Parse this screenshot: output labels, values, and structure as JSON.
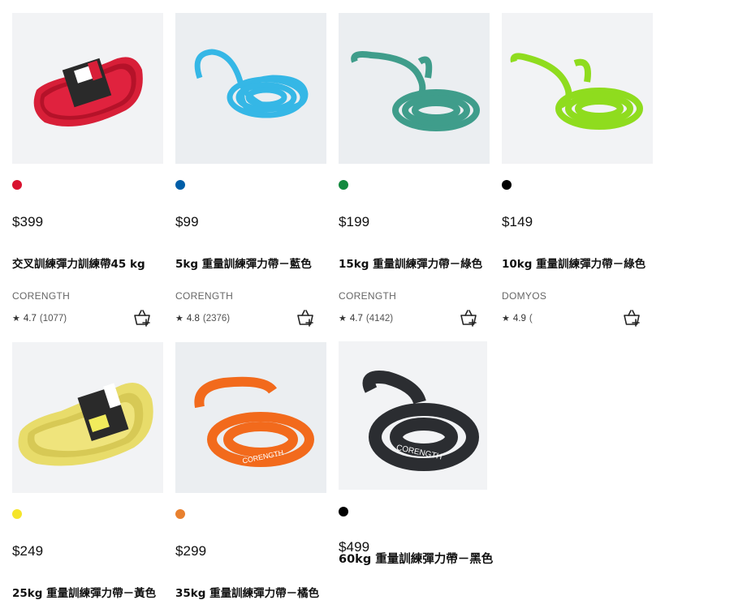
{
  "products": [
    {
      "price": "$399",
      "name": "交叉訓練彈力訓練帶45 kg",
      "brand": "CORENGTH",
      "rating": "4.7",
      "count": "(1077)",
      "swatch": "#d9122f",
      "band_color": "#e0223e",
      "icon": "red-resistance-band-image"
    },
    {
      "price": "$99",
      "name": "5kg 重量訓練彈力帶－藍色",
      "brand": "CORENGTH",
      "rating": "4.8",
      "count": "(2376)",
      "swatch": "#005ea8",
      "band_color": "#35b7e6",
      "icon": "blue-resistance-band-image"
    },
    {
      "price": "$199",
      "name": "15kg 重量訓練彈力帶－綠色",
      "brand": "CORENGTH",
      "rating": "4.7",
      "count": "(4142)",
      "swatch": "#138a3f",
      "band_color": "#3f9d8b",
      "icon": "teal-resistance-band-image"
    },
    {
      "price": "$149",
      "name": "10kg 重量訓練彈力帶－綠色",
      "brand": "DOMYOS",
      "rating": "4.9",
      "count": "(",
      "swatch": "#000000",
      "band_color": "#8fdc1e",
      "icon": "lime-resistance-band-image"
    },
    {
      "price": "$249",
      "name": "25kg 重量訓練彈力帶－黃色",
      "brand": "",
      "rating": "",
      "count": "",
      "swatch": "#f5e52a",
      "band_color": "#e8dc6a",
      "icon": "yellow-resistance-band-image"
    },
    {
      "price": "$299",
      "name": "35kg 重量訓練彈力帶－橘色",
      "brand": "",
      "rating": "",
      "count": "",
      "swatch": "#e8802e",
      "band_color": "#f26a1c",
      "icon": "orange-resistance-band-image"
    },
    {
      "price": "$499",
      "name": "60kg 重量訓練彈力帶－黑色",
      "brand": "",
      "rating": "",
      "count": "",
      "swatch": "#000000",
      "band_color": "#2b2d31",
      "icon": "black-resistance-band-image"
    }
  ],
  "band_text": {
    "orange": "CORENGTH",
    "black": "CORENGTH"
  },
  "icons": {
    "star": "★",
    "cart": "add-to-cart-icon"
  }
}
